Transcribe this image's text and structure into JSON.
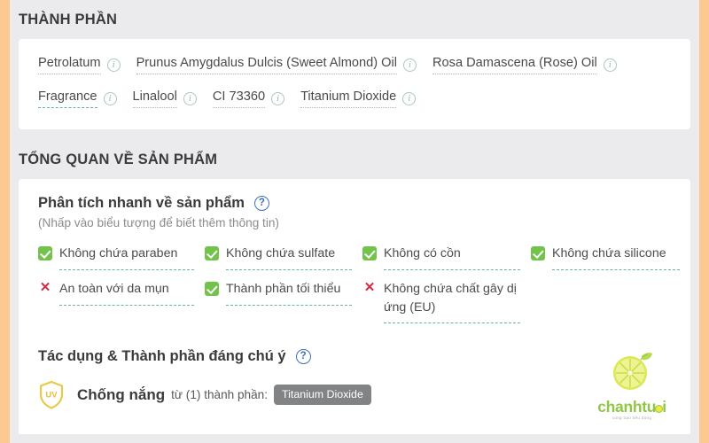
{
  "theme": {
    "rail_color": "#fcca90",
    "page_bg": "#ebebee",
    "card_bg": "#ffffff",
    "accent_green": "#72c24c",
    "accent_red": "#d02b46",
    "accent_blue": "#3f6fb5",
    "tag_gray": "#818385",
    "uv_gold": "#e8c94a",
    "logo_green": "#8cc63f"
  },
  "ingredients_section": {
    "heading": "THÀNH PHẦN",
    "rows": [
      [
        {
          "name": "Petrolatum",
          "flagged": false,
          "info_icon": "info-circle-icon"
        },
        {
          "name": "Prunus Amygdalus Dulcis (Sweet Almond) Oil",
          "flagged": false,
          "info_icon": "info-circle-icon"
        },
        {
          "name": "Rosa Damascena (Rose) Oil",
          "flagged": false,
          "info_icon": "info-circle-icon"
        }
      ],
      [
        {
          "name": "Fragrance",
          "flagged": true,
          "info_icon": "info-circle-icon"
        },
        {
          "name": "Linalool",
          "flagged": false,
          "info_icon": "info-circle-icon"
        },
        {
          "name": "CI 73360",
          "flagged": false,
          "info_icon": "info-circle-icon"
        },
        {
          "name": "Titanium Dioxide",
          "flagged": false,
          "info_icon": "info-circle-icon"
        }
      ]
    ]
  },
  "overview_section": {
    "heading": "TỔNG QUAN VỀ SẢN PHẨM",
    "quick_analysis": {
      "title": "Phân tích nhanh về sản phẩm",
      "help_icon": "help-circle-icon",
      "subtitle": "(Nhấp vào biểu tượng để biết thêm thông tin)",
      "features": [
        {
          "label": "Không chứa paraben",
          "status": "yes",
          "icon": "green-check-icon"
        },
        {
          "label": "Không chứa sulfate",
          "status": "yes",
          "icon": "green-check-icon"
        },
        {
          "label": "Không có cồn",
          "status": "yes",
          "icon": "green-check-icon"
        },
        {
          "label": "Không chứa silicone",
          "status": "yes",
          "icon": "green-check-icon"
        },
        {
          "label": "An toàn với da mụn",
          "status": "no",
          "icon": "red-x-icon"
        },
        {
          "label": "Thành phần tối thiểu",
          "status": "yes",
          "icon": "green-check-icon"
        },
        {
          "label": "Không chứa chất gây dị ứng (EU)",
          "status": "no",
          "icon": "red-x-icon"
        }
      ]
    },
    "benefits": {
      "title": "Tác dụng & Thành phần đáng chú ý",
      "help_icon": "help-circle-icon",
      "items": [
        {
          "icon": "uv-shield-icon",
          "icon_text": "UV",
          "name": "Chống nắng",
          "from_text": "từ (1) thành phần:",
          "tags": [
            "Titanium Dioxide"
          ]
        }
      ]
    }
  },
  "logo": {
    "mark": "lime-slice-icon",
    "word_before": "chanhtu",
    "word_after": "i",
    "tagline": "cùng bạn tiêu dùng"
  }
}
